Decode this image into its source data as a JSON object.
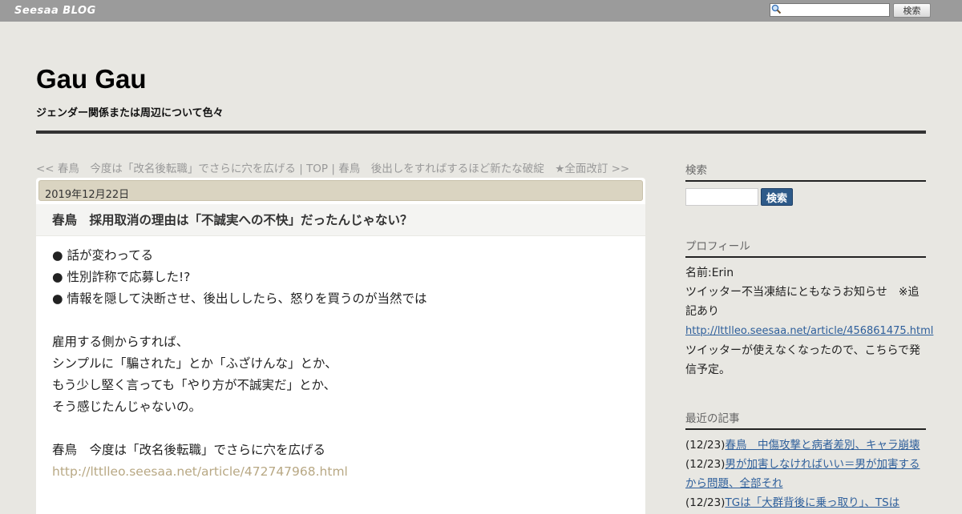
{
  "topbar": {
    "logo": "Seesaa BLOG",
    "search_placeholder": "",
    "search_button": "検索"
  },
  "header": {
    "title": "Gau Gau",
    "description": "ジェンダー関係または周辺について色々"
  },
  "article_nav": {
    "prev": "<< 春鳥　今度は「改名後転職」でさらに穴を広げる",
    "sep1": " | ",
    "top": "TOP",
    "sep2": " | ",
    "next": "春鳥　後出しをすればするほど新たな破綻　★全面改訂 >>"
  },
  "post": {
    "date": "2019年12月22日",
    "title": "春鳥　採用取消の理由は「不誠実への不快」だったんじゃない？",
    "lines": [
      "● 話が変わってる",
      "● 性別詐称で応募した!?",
      "● 情報を隠して決断させ、後出ししたら、怒りを買うのが当然では",
      "",
      "雇用する側からすれば、",
      "シンプルに「騙された」とか「ふざけんな」とか、",
      "もう少し堅く言っても「やり方が不誠実だ」とか、",
      "そう感じたんじゃないの。",
      "",
      "春鳥　今度は「改名後転職」でさらに穴を広げる"
    ],
    "link": "http://lttlleo.seesaa.net/article/472747968.html"
  },
  "sidebar": {
    "search": {
      "heading": "検索",
      "button": "検索"
    },
    "profile": {
      "heading": "プロフィール",
      "name": "名前:Erin",
      "notice": "ツイッター不当凍結にともなうお知らせ　※追記あり",
      "link": "http://lttlleo.seesaa.net/article/456861475.html",
      "note": "ツイッターが使えなくなったので、こちらで発信予定。"
    },
    "recent": {
      "heading": "最近の記事",
      "items": [
        {
          "date": "(12/23)",
          "title": "春鳥　中傷攻撃と病者差別、キャラ崩壊"
        },
        {
          "date": "(12/23)",
          "title": "男が加害しなければいい＝男が加害するから問題、全部それ"
        },
        {
          "date": "(12/23)",
          "title": "TGは「大群背後に乗っ取り」、TSは"
        }
      ]
    }
  }
}
